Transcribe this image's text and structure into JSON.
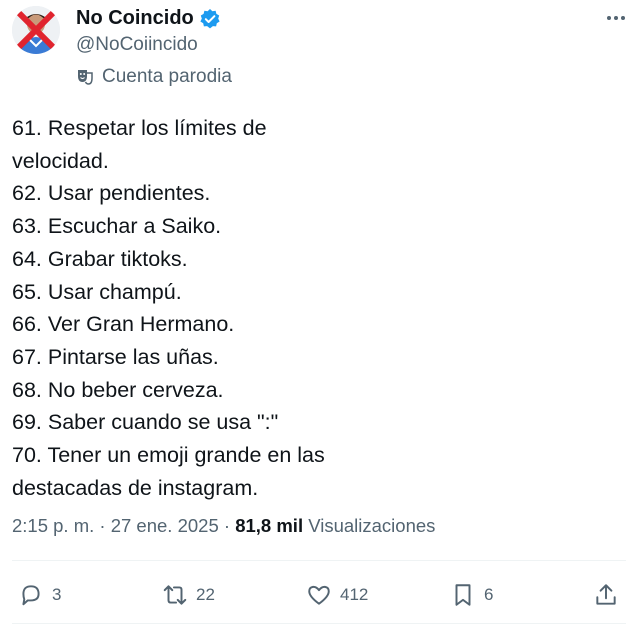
{
  "author": {
    "name": "No Coincido",
    "handle": "@NoCoiincido",
    "label": "Cuenta parodia",
    "verified": true,
    "verified_color": "#1d9bf0"
  },
  "tweet": {
    "lines": [
      "61. Respetar los límites de",
      "velocidad.",
      "62. Usar pendientes.",
      "63. Escuchar a Saiko.",
      "64. Grabar tiktoks.",
      "65. Usar champú.",
      "66. Ver Gran Hermano.",
      "67. Pintarse las uñas.",
      "68. No beber cerveza.",
      "69. Saber cuando se usa \":\"",
      "70. Tener un emoji grande en las",
      "destacadas de instagram."
    ]
  },
  "meta": {
    "time": "2:15 p. m.",
    "date": "27 ene. 2025",
    "views_count": "81,8 mil",
    "views_label": "Visualizaciones"
  },
  "actions": {
    "replies": "3",
    "retweets": "22",
    "likes": "412",
    "bookmarks": "6"
  },
  "icons": {
    "avatar": "avatar-with-red-x",
    "verified": "verified-badge-icon",
    "parody": "theater-mask-icon",
    "more": "more-dots-icon",
    "reply": "reply-icon",
    "retweet": "retweet-icon",
    "like": "heart-icon",
    "bookmark": "bookmark-icon",
    "share": "share-icon"
  }
}
